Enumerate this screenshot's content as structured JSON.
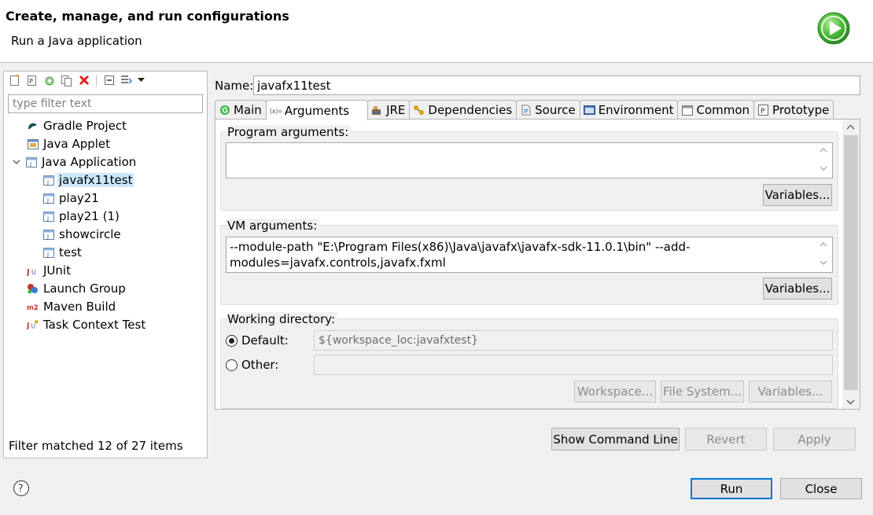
{
  "header": {
    "title": "Create, manage, and run configurations",
    "subtitle": "Run a Java application"
  },
  "left_panel": {
    "filter_placeholder": "type filter text",
    "tree": [
      {
        "label": "Gradle Project",
        "icon": "gradle-icon"
      },
      {
        "label": "Java Applet",
        "icon": "java-applet-icon"
      },
      {
        "label": "Java Application",
        "icon": "java-application-icon",
        "expanded": true
      },
      {
        "label": "javafx11test",
        "icon": "java-config-icon",
        "selected": true
      },
      {
        "label": "play21",
        "icon": "java-config-icon"
      },
      {
        "label": "play21 (1)",
        "icon": "java-config-icon"
      },
      {
        "label": "showcircle",
        "icon": "java-config-icon"
      },
      {
        "label": "test",
        "icon": "java-config-icon"
      },
      {
        "label": "JUnit",
        "icon": "junit-icon"
      },
      {
        "label": "Launch Group",
        "icon": "launch-group-icon"
      },
      {
        "label": "Maven Build",
        "icon": "maven-icon"
      },
      {
        "label": "Task Context Test",
        "icon": "task-context-icon"
      }
    ],
    "status": "Filter matched 12 of 27 items"
  },
  "config": {
    "name_label": "Name:",
    "name_value": "javafx11test",
    "tabs": [
      {
        "label": "Main",
        "icon": "main-tab-icon"
      },
      {
        "label": "Arguments",
        "icon": "arguments-tab-icon",
        "active": true
      },
      {
        "label": "JRE",
        "icon": "jre-tab-icon"
      },
      {
        "label": "Dependencies",
        "icon": "dependencies-tab-icon"
      },
      {
        "label": "Source",
        "icon": "source-tab-icon"
      },
      {
        "label": "Environment",
        "icon": "environment-tab-icon"
      },
      {
        "label": "Common",
        "icon": "common-tab-icon"
      },
      {
        "label": "Prototype",
        "icon": "prototype-tab-icon"
      }
    ],
    "program_args": {
      "legend": "Program arguments:",
      "value": "",
      "variables_button": "Variables..."
    },
    "vm_args": {
      "legend": "VM arguments:",
      "value_line1": "--module-path \"E:\\Program Files(x86)\\Java\\javafx\\javafx-sdk-11.0.1\\bin\" --add-",
      "value_line2": "modules=javafx.controls,javafx.fxml",
      "variables_button": "Variables..."
    },
    "working_dir": {
      "legend": "Working directory:",
      "default_label": "Default:",
      "default_value": "${workspace_loc:javafxtest}",
      "other_label": "Other:",
      "other_value": "",
      "selected": "default",
      "workspace_button": "Workspace...",
      "filesystem_button": "File System...",
      "variables_button": "Variables..."
    },
    "show_command_line_button": "Show Command Line",
    "revert_button": "Revert",
    "apply_button": "Apply"
  },
  "footer": {
    "run_button": "Run",
    "close_button": "Close",
    "help_icon": "help-icon"
  },
  "colors": {
    "selection": "#cce8ff",
    "default_button_border": "#0078d7",
    "run_logo": "#3cb043"
  }
}
